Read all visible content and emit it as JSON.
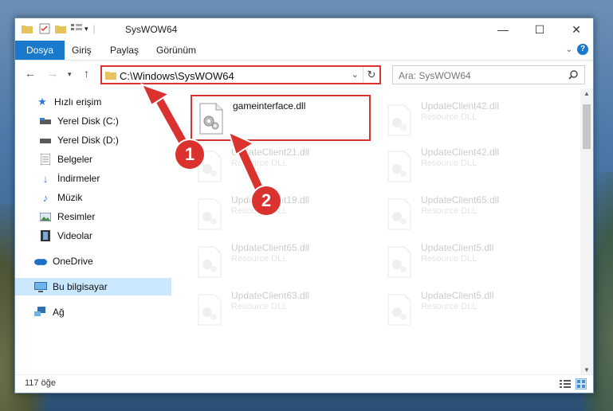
{
  "window": {
    "title": "SysWOW64"
  },
  "ribbon": {
    "tabs": [
      "Dosya",
      "Giriş",
      "Paylaş",
      "Görünüm"
    ]
  },
  "address": {
    "path": "C:\\Windows\\SysWOW64"
  },
  "search": {
    "placeholder": "Ara: SysWOW64"
  },
  "nav": {
    "items": [
      {
        "label": "Hızlı erişim",
        "icon": "star-icon"
      },
      {
        "label": "Yerel Disk (C:)",
        "icon": "drive-icon"
      },
      {
        "label": "Yerel Disk (D:)",
        "icon": "drive-icon"
      },
      {
        "label": "Belgeler",
        "icon": "documents-icon"
      },
      {
        "label": "İndirmeler",
        "icon": "downloads-icon"
      },
      {
        "label": "Müzik",
        "icon": "music-icon"
      },
      {
        "label": "Resimler",
        "icon": "pictures-icon"
      },
      {
        "label": "Videolar",
        "icon": "videos-icon"
      },
      {
        "label": "OneDrive",
        "icon": "cloud-icon"
      },
      {
        "label": "Bu bilgisayar",
        "icon": "computer-icon"
      },
      {
        "label": "Ağ",
        "icon": "network-icon"
      }
    ]
  },
  "files": [
    {
      "name": "gameinterface.dll",
      "desc": ""
    },
    {
      "name": "UpdateClient42.dll",
      "desc": "Resource DLL"
    },
    {
      "name": "UpdateClient21.dll",
      "desc": "Resource DLL"
    },
    {
      "name": "UpdateClient42.dll",
      "desc": "Resource DLL"
    },
    {
      "name": "UpdateClient19.dll",
      "desc": "Resource DLL"
    },
    {
      "name": "UpdateClient65.dll",
      "desc": "Resource DLL"
    },
    {
      "name": "UpdateClient65.dll",
      "desc": "Resource DLL"
    },
    {
      "name": "UpdateClient5.dll",
      "desc": "Resource DLL"
    },
    {
      "name": "UpdateClient63.dll",
      "desc": "Resource DLL"
    },
    {
      "name": "UpdateClient5.dll",
      "desc": "Resource DLL"
    }
  ],
  "status": {
    "count": "117 öğe"
  },
  "annotations": {
    "step1": "1",
    "step2": "2"
  },
  "colors": {
    "accent": "#1979ca",
    "highlight": "#d9322f",
    "selection": "#cce8ff"
  }
}
